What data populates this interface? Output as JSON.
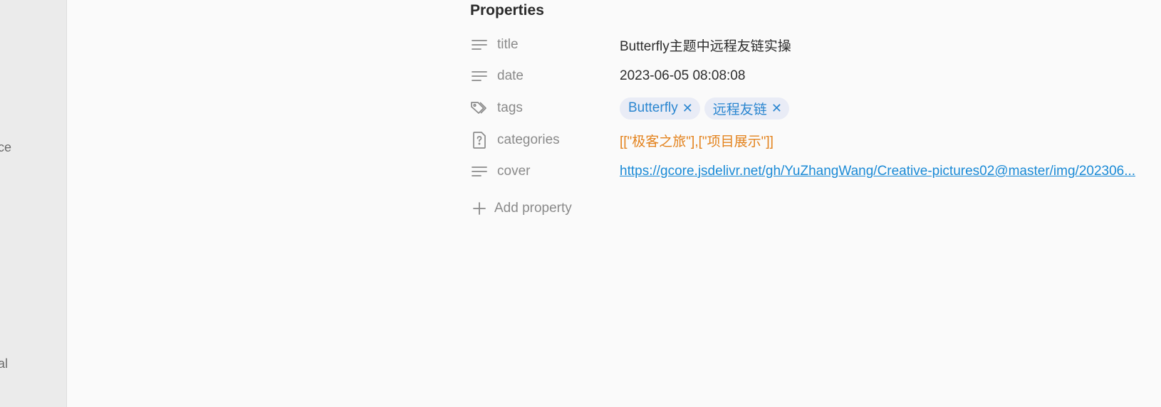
{
  "sidebar": {
    "items": [
      {
        "label": "ce"
      },
      {
        "label": "al"
      }
    ]
  },
  "properties": {
    "heading": "Properties",
    "rows": [
      {
        "key": "title",
        "icon": "text-lines-icon",
        "value": "Butterfly主题中远程友链实操"
      },
      {
        "key": "date",
        "icon": "text-lines-icon",
        "value": "2023-06-05 08:08:08"
      },
      {
        "key": "tags",
        "icon": "tags-icon",
        "tags": [
          "Butterfly",
          "远程友链"
        ]
      },
      {
        "key": "categories",
        "icon": "unknown-file-icon",
        "value": "[[\"极客之旅\"],[\"项目展示\"]]",
        "value_color": "#e3821c"
      },
      {
        "key": "cover",
        "icon": "text-lines-icon",
        "value": "https://gcore.jsdelivr.net/gh/YuZhangWang/Creative-pictures02@master/img/202306..."
      }
    ],
    "add_label": "Add property",
    "tag_remove_glyph": "✕"
  },
  "colors": {
    "link": "#1a8ad6",
    "tag_bg": "#e9ecf6",
    "tag_text": "#2b86d0",
    "category_text": "#e3821c"
  }
}
